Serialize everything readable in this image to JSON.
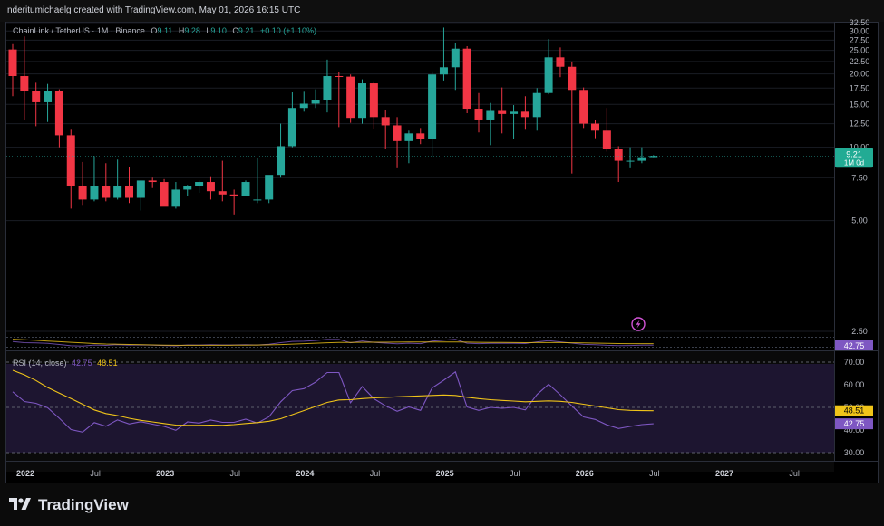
{
  "header": {
    "attribution": "nderitumichaelg created with TradingView.com, May 01, 2026 16:15 UTC"
  },
  "legend": {
    "symbol": "ChainLink / TetherUS · 1M · Binance",
    "o_label": "O",
    "o_value": "9.11",
    "h_label": "H",
    "h_value": "9.28",
    "l_label": "L",
    "l_value": "9.10",
    "c_label": "C",
    "c_value": "9.21",
    "change": "+0.10 (+1.10%)"
  },
  "rsi_legend": {
    "name": "RSI (14, close)",
    "rsi_value": "42.75",
    "ma_value": "48.51"
  },
  "brand": {
    "name": "TradingView"
  },
  "colors": {
    "up": "#26a69a",
    "down": "#f23645",
    "rsi": "#7e57c2",
    "rsi_ma": "#f0c419",
    "price_tag": "#22ab94"
  },
  "chart_data": [
    {
      "type": "candlestick",
      "title": "ChainLink / TetherUS · 1M · Binance",
      "y_scale": "log",
      "ylim": [
        4.6,
        33.5
      ],
      "y_ticks": [
        "32.50",
        "30.00",
        "27.50",
        "25.00",
        "22.50",
        "20.00",
        "17.50",
        "15.00",
        "12.50",
        "10.00",
        "7.50",
        "5.00",
        "2.50"
      ],
      "x_ticks": [
        "2022",
        "Jul",
        "2023",
        "Jul",
        "2024",
        "Jul",
        "2025",
        "Jul",
        "2026",
        "Jul",
        "2027",
        "Jul"
      ],
      "last_price": "9.21",
      "last_price_sub": "1M 0d",
      "candles": [
        {
          "date": "2022-01",
          "o": 25.2,
          "h": 26.5,
          "l": 16.2,
          "c": 19.6
        },
        {
          "date": "2022-02",
          "o": 19.6,
          "h": 28.5,
          "l": 13.0,
          "c": 17.0
        },
        {
          "date": "2022-03",
          "o": 17.0,
          "h": 18.4,
          "l": 12.2,
          "c": 15.3
        },
        {
          "date": "2022-04",
          "o": 15.3,
          "h": 18.2,
          "l": 12.7,
          "c": 17.0
        },
        {
          "date": "2022-05",
          "o": 17.0,
          "h": 17.3,
          "l": 10.0,
          "c": 11.2
        },
        {
          "date": "2022-06",
          "o": 11.2,
          "h": 11.8,
          "l": 5.6,
          "c": 6.9
        },
        {
          "date": "2022-07",
          "o": 6.9,
          "h": 8.7,
          "l": 5.8,
          "c": 6.1
        },
        {
          "date": "2022-08",
          "o": 6.1,
          "h": 9.2,
          "l": 6.0,
          "c": 6.9
        },
        {
          "date": "2022-09",
          "o": 6.9,
          "h": 8.6,
          "l": 6.0,
          "c": 6.2
        },
        {
          "date": "2022-10",
          "o": 6.2,
          "h": 8.9,
          "l": 6.1,
          "c": 6.9
        },
        {
          "date": "2022-11",
          "o": 6.9,
          "h": 8.3,
          "l": 5.9,
          "c": 6.2
        },
        {
          "date": "2022-12",
          "o": 6.2,
          "h": 7.3,
          "l": 5.5,
          "c": 7.3
        },
        {
          "date": "2023-01",
          "o": 7.3,
          "h": 7.5,
          "l": 6.8,
          "c": 7.2
        },
        {
          "date": "2023-02",
          "o": 7.2,
          "h": 7.4,
          "l": 5.8,
          "c": 5.7
        },
        {
          "date": "2023-03",
          "o": 5.7,
          "h": 7.2,
          "l": 5.6,
          "c": 6.7
        },
        {
          "date": "2023-04",
          "o": 6.7,
          "h": 7.0,
          "l": 6.3,
          "c": 6.9
        },
        {
          "date": "2023-05",
          "o": 6.9,
          "h": 7.3,
          "l": 6.5,
          "c": 7.2
        },
        {
          "date": "2023-06",
          "o": 7.2,
          "h": 7.6,
          "l": 6.1,
          "c": 6.6
        },
        {
          "date": "2023-07",
          "o": 6.6,
          "h": 8.8,
          "l": 6.0,
          "c": 6.4
        },
        {
          "date": "2023-08",
          "o": 6.4,
          "h": 6.7,
          "l": 5.3,
          "c": 6.3
        },
        {
          "date": "2023-09",
          "o": 6.3,
          "h": 7.3,
          "l": 6.3,
          "c": 7.2
        },
        {
          "date": "2023-10",
          "o": 6.1,
          "h": 9.0,
          "l": 5.9,
          "c": 6.1
        },
        {
          "date": "2023-11",
          "o": 6.1,
          "h": 7.6,
          "l": 5.9,
          "c": 7.7
        },
        {
          "date": "2023-12",
          "o": 7.7,
          "h": 12.5,
          "l": 7.5,
          "c": 10.1
        },
        {
          "date": "2024-01",
          "o": 10.1,
          "h": 16.8,
          "l": 10.0,
          "c": 14.5
        },
        {
          "date": "2024-02",
          "o": 14.5,
          "h": 16.9,
          "l": 14.0,
          "c": 15.1
        },
        {
          "date": "2024-03",
          "o": 15.1,
          "h": 17.3,
          "l": 14.5,
          "c": 15.6
        },
        {
          "date": "2024-04",
          "o": 15.6,
          "h": 22.9,
          "l": 13.9,
          "c": 19.6
        },
        {
          "date": "2024-05",
          "o": 19.6,
          "h": 20.3,
          "l": 12.1,
          "c": 19.5
        },
        {
          "date": "2024-06",
          "o": 19.5,
          "h": 19.9,
          "l": 12.6,
          "c": 13.2
        },
        {
          "date": "2024-07",
          "o": 13.2,
          "h": 19.0,
          "l": 12.5,
          "c": 18.3
        },
        {
          "date": "2024-08",
          "o": 18.3,
          "h": 18.5,
          "l": 11.9,
          "c": 13.3
        },
        {
          "date": "2024-09",
          "o": 13.3,
          "h": 14.2,
          "l": 9.8,
          "c": 12.3
        },
        {
          "date": "2024-10",
          "o": 12.3,
          "h": 13.3,
          "l": 8.2,
          "c": 10.6
        },
        {
          "date": "2024-11",
          "o": 10.6,
          "h": 11.7,
          "l": 8.6,
          "c": 11.4
        },
        {
          "date": "2024-12",
          "o": 11.4,
          "h": 12.0,
          "l": 10.3,
          "c": 10.8
        },
        {
          "date": "2025-01",
          "o": 10.8,
          "h": 20.5,
          "l": 9.2,
          "c": 19.9
        },
        {
          "date": "2025-02",
          "o": 19.9,
          "h": 31.0,
          "l": 18.8,
          "c": 21.3
        },
        {
          "date": "2025-03",
          "o": 21.3,
          "h": 26.7,
          "l": 17.2,
          "c": 25.4
        },
        {
          "date": "2025-04",
          "o": 25.4,
          "h": 26.0,
          "l": 13.8,
          "c": 14.4
        },
        {
          "date": "2025-05",
          "o": 14.4,
          "h": 16.7,
          "l": 11.5,
          "c": 13.0
        },
        {
          "date": "2025-06",
          "o": 13.0,
          "h": 15.2,
          "l": 10.2,
          "c": 14.1
        },
        {
          "date": "2025-07",
          "o": 14.1,
          "h": 17.6,
          "l": 11.4,
          "c": 13.7
        },
        {
          "date": "2025-08",
          "o": 13.7,
          "h": 14.9,
          "l": 10.8,
          "c": 14.0
        },
        {
          "date": "2025-09",
          "o": 14.0,
          "h": 16.2,
          "l": 11.8,
          "c": 13.3
        },
        {
          "date": "2025-10",
          "o": 13.3,
          "h": 17.5,
          "l": 11.7,
          "c": 16.7
        },
        {
          "date": "2025-11",
          "o": 16.7,
          "h": 27.8,
          "l": 16.5,
          "c": 23.4
        },
        {
          "date": "2025-12",
          "o": 23.4,
          "h": 25.7,
          "l": 19.4,
          "c": 21.4
        },
        {
          "date": "2026-01",
          "o": 21.4,
          "h": 22.5,
          "l": 7.8,
          "c": 17.2
        },
        {
          "date": "2026-02",
          "o": 17.2,
          "h": 17.6,
          "l": 12.0,
          "c": 12.5
        },
        {
          "date": "2026-03",
          "o": 12.5,
          "h": 13.0,
          "l": 10.9,
          "c": 11.7
        },
        {
          "date": "2026-04",
          "o": 11.7,
          "h": 14.5,
          "l": 9.6,
          "c": 9.8
        },
        {
          "date": "2026-05",
          "o": 9.8,
          "h": 10.1,
          "l": 7.2,
          "c": 8.8
        },
        {
          "date": "2026-06",
          "o": 8.8,
          "h": 10.0,
          "l": 8.2,
          "c": 8.8
        },
        {
          "date": "2026-07",
          "o": 8.8,
          "h": 10.0,
          "l": 8.6,
          "c": 9.1
        },
        {
          "date": "2026-08",
          "o": 9.11,
          "h": 9.28,
          "l": 9.1,
          "c": 9.21
        }
      ]
    },
    {
      "type": "line",
      "title": "RSI (14, close)",
      "ylim": [
        25,
        77
      ],
      "y_ticks": [
        "70.00",
        "60.00",
        "50.00",
        "40.00",
        "30.00"
      ],
      "levels": [
        70,
        50,
        30
      ],
      "value_tags": [
        "48.51",
        "42.75"
      ],
      "series": [
        {
          "name": "RSI",
          "values": [
            56.9,
            52.6,
            51.8,
            49.9,
            45.2,
            40.2,
            39.1,
            43.3,
            41.7,
            44.5,
            42.7,
            43.7,
            42.6,
            41.6,
            39.9,
            43.6,
            43.1,
            44.4,
            43.4,
            43.4,
            44.8,
            43.1,
            45.9,
            52.5,
            57.4,
            58.3,
            61.2,
            65.4,
            65.4,
            52.1,
            59.2,
            53.9,
            50.7,
            48.3,
            50.2,
            48.7,
            58.6,
            62.0,
            65.7,
            50.2,
            48.7,
            50.0,
            49.6,
            50.0,
            48.9,
            55.7,
            60.2,
            55.6,
            50.6,
            45.8,
            44.7,
            42.3,
            40.7,
            41.6,
            42.4,
            42.75
          ]
        },
        {
          "name": "RSI-based MA",
          "values": [
            66.4,
            64.4,
            61.9,
            58.8,
            56.3,
            53.9,
            51.4,
            48.9,
            47.3,
            46.4,
            45.2,
            44.3,
            43.6,
            42.9,
            42.2,
            42.1,
            42.1,
            42.2,
            42.1,
            42.4,
            42.9,
            43.3,
            43.9,
            45.0,
            46.8,
            48.6,
            50.4,
            52.2,
            53.3,
            53.4,
            53.9,
            54.2,
            54.4,
            54.7,
            54.9,
            55.1,
            55.3,
            55.5,
            55.3,
            54.5,
            53.9,
            53.4,
            53.1,
            52.8,
            52.5,
            52.7,
            52.9,
            52.7,
            52.2,
            51.4,
            50.6,
            49.8,
            49.0,
            48.7,
            48.55,
            48.51
          ]
        }
      ]
    }
  ]
}
